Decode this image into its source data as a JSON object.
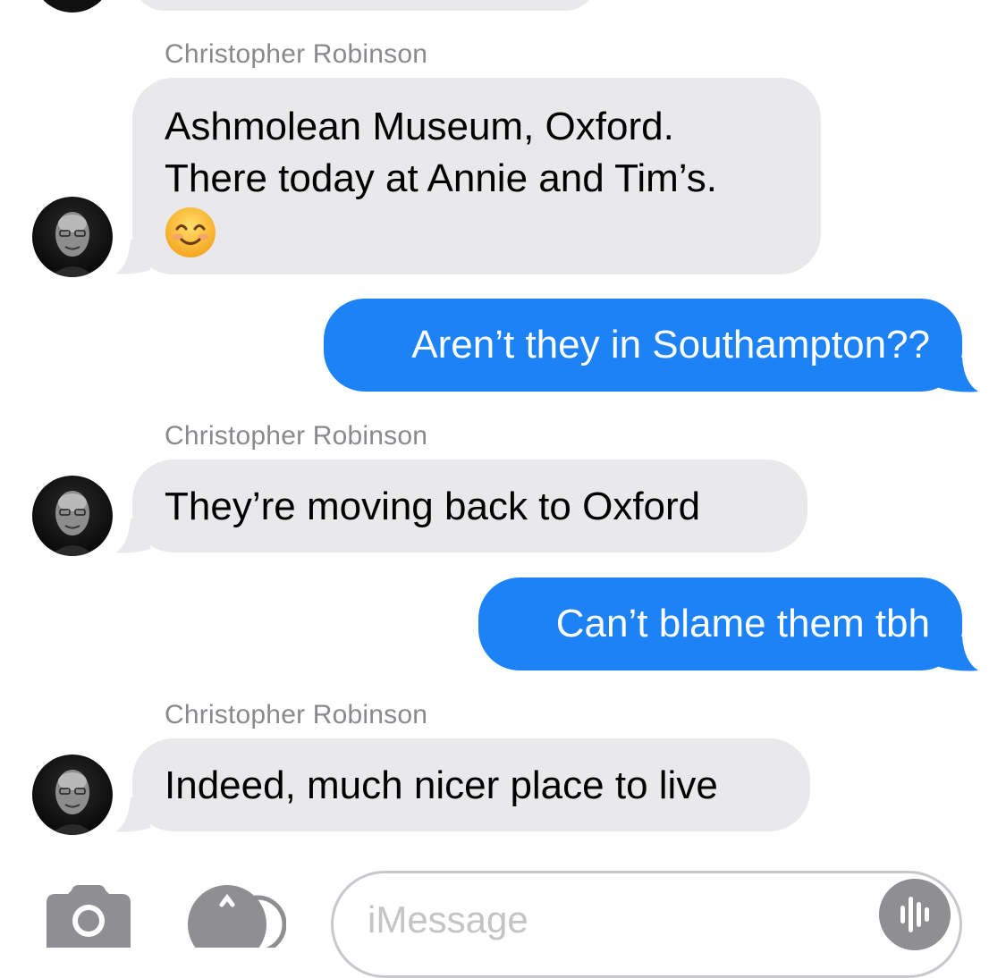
{
  "thread": {
    "messages": [
      {
        "sender": "Christopher Robinson",
        "direction": "incoming",
        "lines": [
          "Ashmolean Museum, Oxford.",
          "There today at Annie and Tim’s."
        ],
        "emoji": "smiling-face-emoji"
      },
      {
        "direction": "outgoing",
        "text": "Aren’t they in Southampton??"
      },
      {
        "sender": "Christopher Robinson",
        "direction": "incoming",
        "text": "They’re moving back to Oxford"
      },
      {
        "direction": "outgoing",
        "text": "Can’t blame them tbh"
      },
      {
        "sender": "Christopher Robinson",
        "direction": "incoming",
        "text": "Indeed, much nicer place to live"
      }
    ]
  },
  "composer": {
    "placeholder": "iMessage",
    "icons": [
      "camera-icon",
      "app-store-icon",
      "audio-waveform-icon"
    ]
  },
  "colors": {
    "incoming_bubble": "#e9e9eb",
    "outgoing_bubble": "#1c82f5",
    "sender_name": "#8a8a8e",
    "placeholder": "#c4c4c6"
  }
}
